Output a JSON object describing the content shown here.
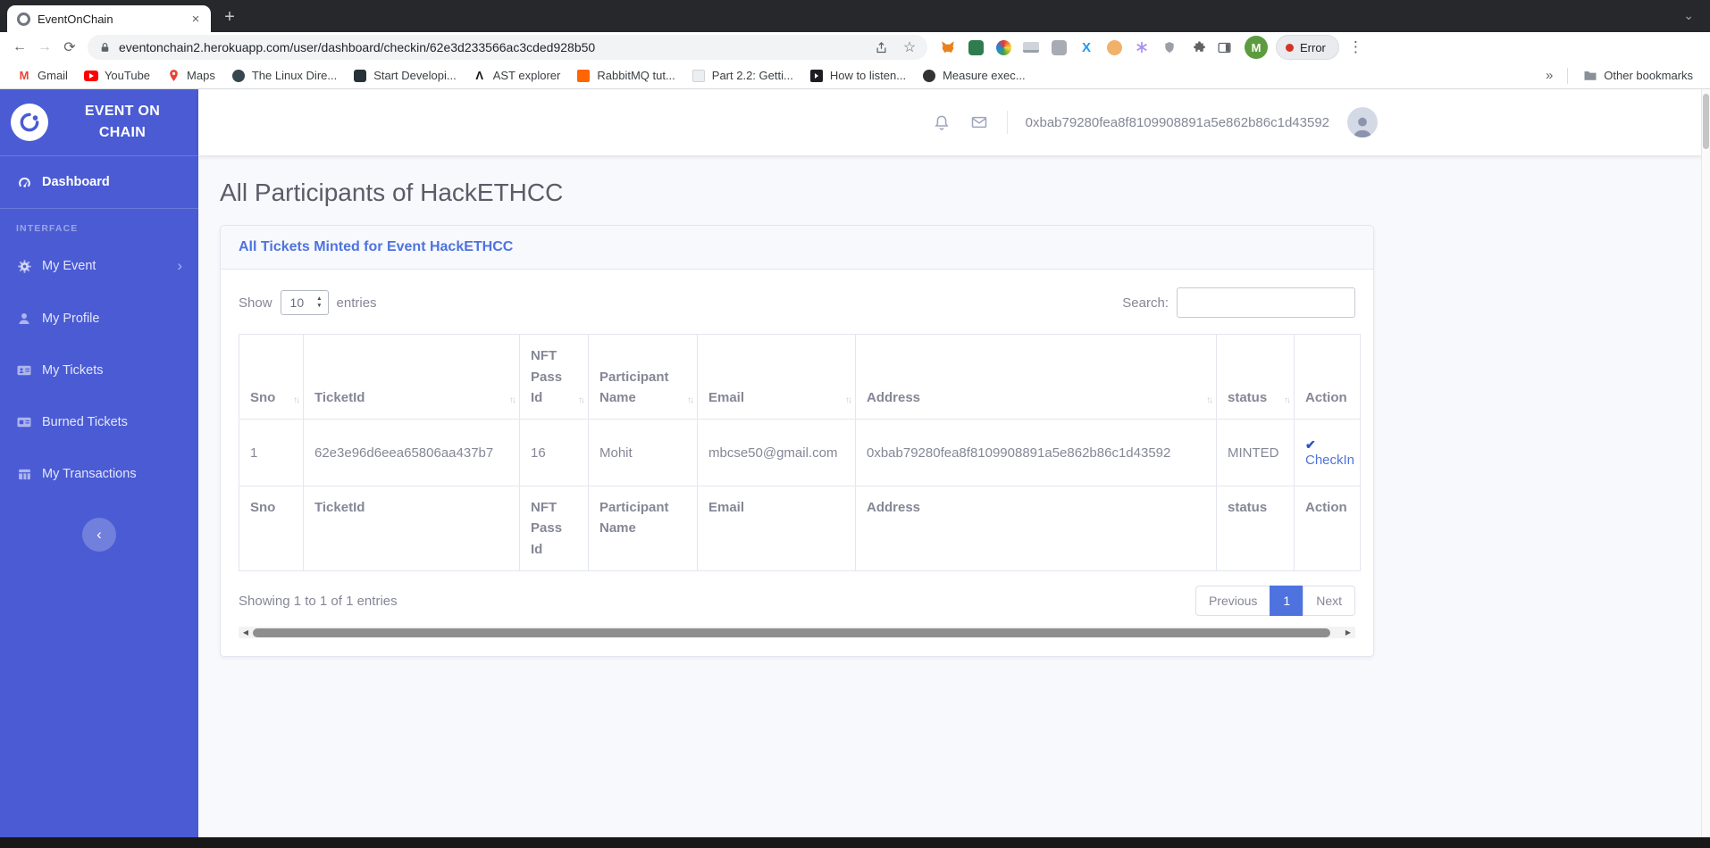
{
  "browser": {
    "tab_title": "EventOnChain",
    "url": "eventonchain2.herokuapp.com/user/dashboard/checkin/62e3d233566ac3cded928b50",
    "profile_initial": "M",
    "error_label": "Error",
    "bookmarks": [
      "Gmail",
      "YouTube",
      "Maps",
      "The Linux Dire...",
      "Start Developi...",
      "AST explorer",
      "RabbitMQ tut...",
      "Part 2.2: Getti...",
      "How to listen...",
      "Measure exec..."
    ],
    "other_bookmarks": "Other bookmarks"
  },
  "sidebar": {
    "brand_line1": "EVENT ON",
    "brand_line2": "CHAIN",
    "dashboard_label": "Dashboard",
    "section_label": "INTERFACE",
    "items": [
      "My Event",
      "My Profile",
      "My Tickets",
      "Burned Tickets",
      "My Transactions"
    ]
  },
  "topbar": {
    "wallet_address": "0xbab79280fea8f8109908891a5e862b86c1d43592"
  },
  "page": {
    "title": "All Participants of HackETHCC",
    "card_header": "All Tickets Minted for Event HackETHCC",
    "controls": {
      "show_label": "Show",
      "page_length": "10",
      "entries_label": "entries",
      "search_label": "Search:",
      "search_value": ""
    },
    "table": {
      "columns": [
        "Sno",
        "TicketId",
        "NFT Pass Id",
        "Participant Name",
        "Email",
        "Address",
        "status",
        "Action"
      ],
      "rows": [
        {
          "sno": "1",
          "ticket_id": "62e3e96d6eea65806aa437b7",
          "nft_pass_id": "16",
          "participant_name": "Mohit",
          "email": "mbcse50@gmail.com",
          "address": "0xbab79280fea8f8109908891a5e862b86c1d43592",
          "status": "MINTED",
          "action_label": "CheckIn"
        }
      ]
    },
    "info": "Showing 1 to 1 of 1 entries",
    "pagination": {
      "previous": "Previous",
      "current": "1",
      "next": "Next"
    }
  },
  "colors": {
    "accent": "#4e73df",
    "sidebar": "#4a5bd4",
    "page_background": "#f8f9fc",
    "muted_text": "#858796",
    "table_border": "#e3e6f0"
  }
}
